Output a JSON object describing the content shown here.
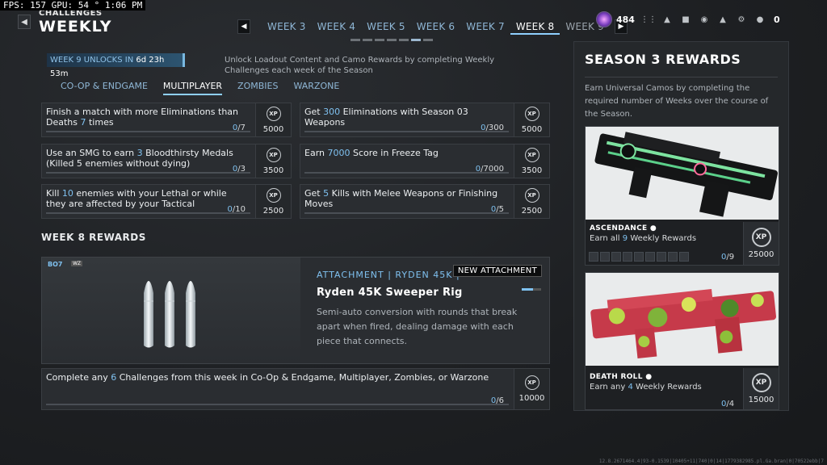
{
  "overlay": {
    "fps_text": "FPS: 157 GPU: 54 ° 1:06 PM"
  },
  "header": {
    "back_icon": "chevron-left-icon",
    "title_small": "CHALLENGES",
    "title_big": "WEEKLY",
    "weeks": [
      "WEEK 3",
      "WEEK 4",
      "WEEK 5",
      "WEEK 6",
      "WEEK 7",
      "WEEK 8",
      "WEEK 9"
    ],
    "active_week": "WEEK 8",
    "cod_points": "484",
    "friends_count": "0"
  },
  "unlock": {
    "label": "WEEK 9 UNLOCKS IN",
    "timer": "6d 23h 53m",
    "description": "Unlock Loadout Content and Camo Rewards by completing Weekly Challenges each week of the Season"
  },
  "mode_tabs": [
    "CO-OP & ENDGAME",
    "MULTIPLAYER",
    "ZOMBIES",
    "WARZONE"
  ],
  "active_mode": "MULTIPLAYER",
  "challenges": [
    {
      "pre": "Finish a match with more Eliminations than Deaths ",
      "hl": "7",
      "post": " times",
      "progress": "0",
      "total": "/7",
      "xp": "5000"
    },
    {
      "pre": "Get ",
      "hl": "300",
      "post": " Eliminations with Season 03 Weapons",
      "progress": "0",
      "total": "/300",
      "xp": "5000"
    },
    {
      "pre": "Use an SMG to earn ",
      "hl": "3",
      "post": " Bloodthirsty Medals (Killed 5 enemies without dying)",
      "progress": "0",
      "total": "/3",
      "xp": "3500"
    },
    {
      "pre": "Earn ",
      "hl": "7000",
      "post": " Score in Freeze Tag",
      "progress": "0",
      "total": "/7000",
      "xp": "3500"
    },
    {
      "pre": "Kill ",
      "hl": "10",
      "post": " enemies with your Lethal or while they are affected by your Tactical",
      "progress": "0",
      "total": "/10",
      "xp": "2500"
    },
    {
      "pre": "Get ",
      "hl": "5",
      "post": " Kills with Melee Weapons or Finishing Moves",
      "progress": "0",
      "total": "/5",
      "xp": "2500"
    }
  ],
  "xp_label": "XP",
  "week_rewards": {
    "title": "WEEK 8 REWARDS",
    "game_tag": "BO7",
    "version_tag": "WZ",
    "attachment_type": "ATTACHMENT  |  RYDEN 45K  |",
    "badge": "NEW ATTACHMENT",
    "name": "Ryden 45K Sweeper Rig",
    "description": "Semi-auto conversion with rounds that break apart when fired, dealing damage with each piece that connects."
  },
  "meta_challenge": {
    "pre": "Complete any ",
    "hl": "6",
    "post": " Challenges from this week in Co-Op & Endgame, Multiplayer, Zombies, or Warzone",
    "progress": "0",
    "total": "/6",
    "xp": "10000"
  },
  "season": {
    "title": "SEASON 3 REWARDS",
    "description": "Earn Universal Camos by completing the required number of Weeks over the course of the Season.",
    "camos": [
      {
        "name": "ASCENDANCE",
        "sub_pre": "Earn all ",
        "sub_hl": "9",
        "sub_post": " Weekly Rewards",
        "progress": "0",
        "total": "/9",
        "xp": "25000"
      },
      {
        "name": "DEATH ROLL",
        "sub_pre": "Earn any ",
        "sub_hl": "4",
        "sub_post": " Weekly Rewards",
        "progress": "0",
        "total": "/4",
        "xp": "15000"
      }
    ]
  },
  "build_info": "12.8.2671464.4|93-0.1539|10405+11|740|0|14|1779382985.pl.Ga.bran|0|70522ebb|7"
}
